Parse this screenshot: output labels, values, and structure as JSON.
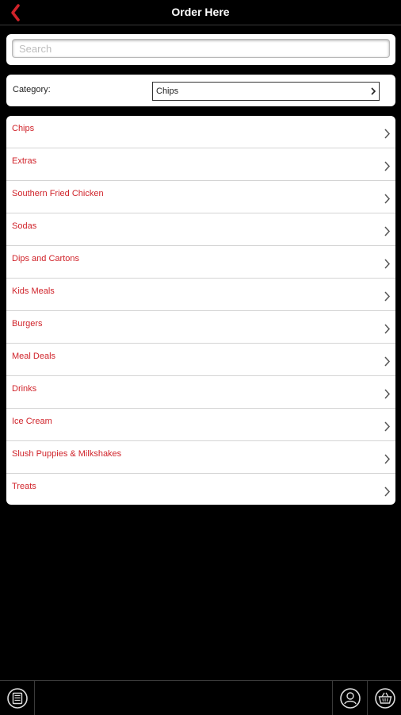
{
  "header": {
    "title": "Order Here",
    "back_icon": "chevron-left-icon",
    "accent_color": "#d0232a"
  },
  "search": {
    "placeholder": "Search",
    "value": ""
  },
  "category": {
    "label": "Category:",
    "selected": "Chips"
  },
  "menu": {
    "items": [
      {
        "label": "Chips"
      },
      {
        "label": "Extras"
      },
      {
        "label": "Southern Fried Chicken"
      },
      {
        "label": "Sodas"
      },
      {
        "label": "Dips and Cartons"
      },
      {
        "label": "Kids Meals"
      },
      {
        "label": "Burgers"
      },
      {
        "label": "Meal Deals"
      },
      {
        "label": "Drinks"
      },
      {
        "label": "Ice Cream"
      },
      {
        "label": "Slush Puppies & Milkshakes"
      },
      {
        "label": "Treats"
      }
    ]
  },
  "bottom_bar": {
    "left_icon": "menu-list-icon",
    "account_icon": "account-icon",
    "basket_icon": "basket-icon"
  }
}
